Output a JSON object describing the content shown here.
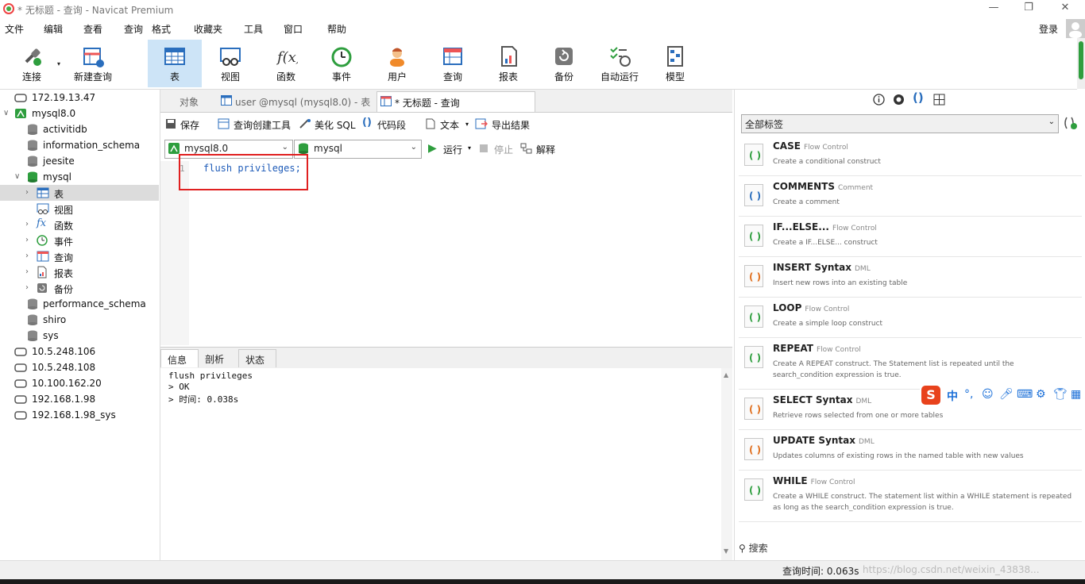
{
  "window": {
    "title": "* 无标题 - 查询 - Navicat Premium",
    "minimize": "—",
    "restore": "❐",
    "close": "✕"
  },
  "menu": [
    "文件",
    "编辑",
    "查看",
    "查询",
    "格式",
    "收藏夹",
    "工具",
    "窗口",
    "帮助"
  ],
  "login": "登录",
  "toolbar": [
    {
      "label": "连接",
      "icon": "plug-icon"
    },
    {
      "label": "新建查询",
      "icon": "new-query-icon"
    },
    {
      "label": "表",
      "icon": "table-icon"
    },
    {
      "label": "视图",
      "icon": "view-icon"
    },
    {
      "label": "函数",
      "icon": "function-icon"
    },
    {
      "label": "事件",
      "icon": "clock-icon"
    },
    {
      "label": "用户",
      "icon": "user-icon"
    },
    {
      "label": "查询",
      "icon": "query-icon"
    },
    {
      "label": "报表",
      "icon": "report-icon"
    },
    {
      "label": "备份",
      "icon": "backup-icon"
    },
    {
      "label": "自动运行",
      "icon": "schedule-icon"
    },
    {
      "label": "模型",
      "icon": "model-icon"
    }
  ],
  "sidebar": [
    {
      "label": "172.19.13.47",
      "level": 0,
      "type": "conn"
    },
    {
      "label": "mysql8.0",
      "level": 0,
      "type": "conn-open"
    },
    {
      "label": "activitidb",
      "level": 1,
      "type": "db"
    },
    {
      "label": "information_schema",
      "level": 1,
      "type": "db"
    },
    {
      "label": "jeesite",
      "level": 1,
      "type": "db"
    },
    {
      "label": "mysql",
      "level": 1,
      "type": "db-open"
    },
    {
      "label": "表",
      "level": 2,
      "type": "table"
    },
    {
      "label": "视图",
      "level": 2,
      "type": "view"
    },
    {
      "label": "函数",
      "level": 2,
      "type": "func"
    },
    {
      "label": "事件",
      "level": 2,
      "type": "event"
    },
    {
      "label": "查询",
      "level": 2,
      "type": "query"
    },
    {
      "label": "报表",
      "level": 2,
      "type": "report"
    },
    {
      "label": "备份",
      "level": 2,
      "type": "backup"
    },
    {
      "label": "performance_schema",
      "level": 1,
      "type": "db"
    },
    {
      "label": "shiro",
      "level": 1,
      "type": "db"
    },
    {
      "label": "sys",
      "level": 1,
      "type": "db"
    },
    {
      "label": "10.5.248.106",
      "level": 0,
      "type": "conn"
    },
    {
      "label": "10.5.248.108",
      "level": 0,
      "type": "conn"
    },
    {
      "label": "10.100.162.20",
      "level": 0,
      "type": "conn"
    },
    {
      "label": "192.168.1.98",
      "level": 0,
      "type": "conn"
    },
    {
      "label": "192.168.1.98_sys",
      "level": 0,
      "type": "conn"
    }
  ],
  "tabs": {
    "objects": "对象",
    "user_table": "user @mysql (mysql8.0) - 表",
    "query": "* 无标题 - 查询"
  },
  "editor_tools": {
    "save": "保存",
    "builder": "查询创建工具",
    "beautify": "美化 SQL",
    "snippet": "代码段",
    "text": "文本",
    "export": "导出结果"
  },
  "selectors": {
    "connection": "mysql8.0",
    "database": "mysql",
    "run": "运行",
    "stop": "停止",
    "explain": "解释"
  },
  "editor": {
    "line_number": "1",
    "code": "flush privileges;"
  },
  "result_tabs": [
    "信息",
    "剖析",
    "状态"
  ],
  "result_lines": [
    "flush privileges",
    "> OK",
    "> 时间: 0.038s"
  ],
  "right_panel": {
    "tag_select": "全部标签",
    "search": "搜索",
    "snippets": [
      {
        "title": "CASE",
        "category": "Flow Control",
        "desc": "Create a conditional construct"
      },
      {
        "title": "COMMENTS",
        "category": "Comment",
        "desc": "Create a comment"
      },
      {
        "title": "IF...ELSE...",
        "category": "Flow Control",
        "desc": "Create a IF...ELSE... construct"
      },
      {
        "title": "INSERT Syntax",
        "category": "DML",
        "desc": "Insert new rows into an existing table"
      },
      {
        "title": "LOOP",
        "category": "Flow Control",
        "desc": "Create a simple loop construct"
      },
      {
        "title": "REPEAT",
        "category": "Flow Control",
        "desc": "Create A REPEAT construct. The Statement list is repeated until the search_condition expression is true."
      },
      {
        "title": "SELECT Syntax",
        "category": "DML",
        "desc": "Retrieve rows selected from one or more tables"
      },
      {
        "title": "UPDATE Syntax",
        "category": "DML",
        "desc": "Updates columns of existing rows in the named table with new values"
      },
      {
        "title": "WHILE",
        "category": "Flow Control",
        "desc": "Create a WHILE construct. The statement list within a WHILE statement is repeated as long as the search_condition expression is true."
      }
    ]
  },
  "status": {
    "query_time": "查询时间: 0.063s",
    "watermark": "https://blog.csdn.net/weixin_43838..."
  },
  "ime": {
    "lang": "中",
    "punct": "°,"
  },
  "colors": {
    "accent": "#1e5bb8",
    "selection": "#cde4f7",
    "highlight_box": "#e02020",
    "db_green": "#2e9e3e"
  }
}
